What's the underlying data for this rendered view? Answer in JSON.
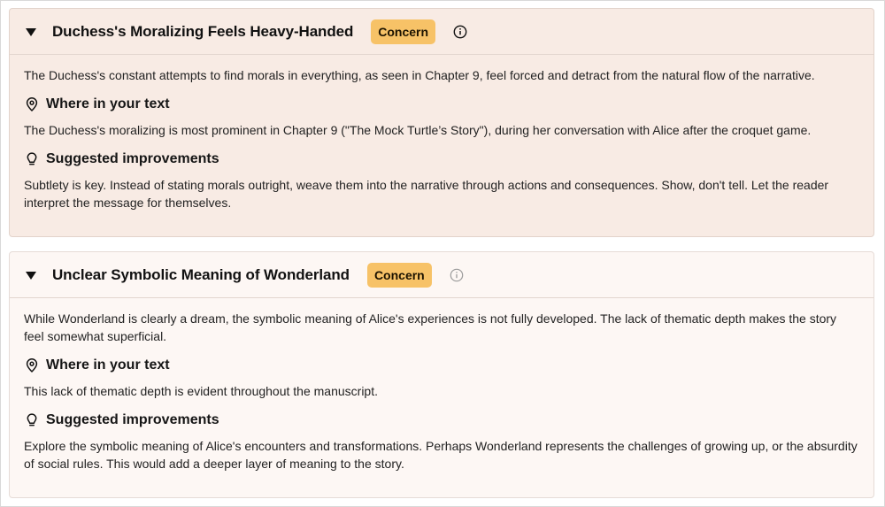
{
  "cards": [
    {
      "title": "Duchess's Moralizing Feels Heavy-Handed",
      "badge": "Concern",
      "description": "The Duchess's constant attempts to find morals in everything, as seen in Chapter 9, feel forced and detract from the natural flow of the narrative.",
      "where_label": "Where in your text",
      "where_text": "The Duchess's moralizing is most prominent in Chapter 9 (\"The Mock Turtle’s Story\"), during her conversation with Alice after the croquet game.",
      "suggest_label": "Suggested improvements",
      "suggest_text": "Subtlety is key. Instead of stating morals outright, weave them into the narrative through actions and consequences. Show, don't tell. Let the reader interpret the message for themselves."
    },
    {
      "title": "Unclear Symbolic Meaning of Wonderland",
      "badge": "Concern",
      "description": "While Wonderland is clearly a dream, the symbolic meaning of Alice's experiences is not fully developed. The lack of thematic depth makes the story feel somewhat superficial.",
      "where_label": "Where in your text",
      "where_text": "This lack of thematic depth is evident throughout the manuscript.",
      "suggest_label": "Suggested improvements",
      "suggest_text": "Explore the symbolic meaning of Alice's encounters and transformations. Perhaps Wonderland represents the challenges of growing up, or the absurdity of social rules. This would add a deeper layer of meaning to the story."
    }
  ],
  "icons": {
    "toggle": "caret-down-icon",
    "info": "info-icon",
    "where": "map-pin-icon",
    "suggest": "lightbulb-icon"
  },
  "colors": {
    "badge": "#f7c267",
    "card1_bg": "#f8ebe4",
    "card2_bg": "#fdf7f4"
  }
}
